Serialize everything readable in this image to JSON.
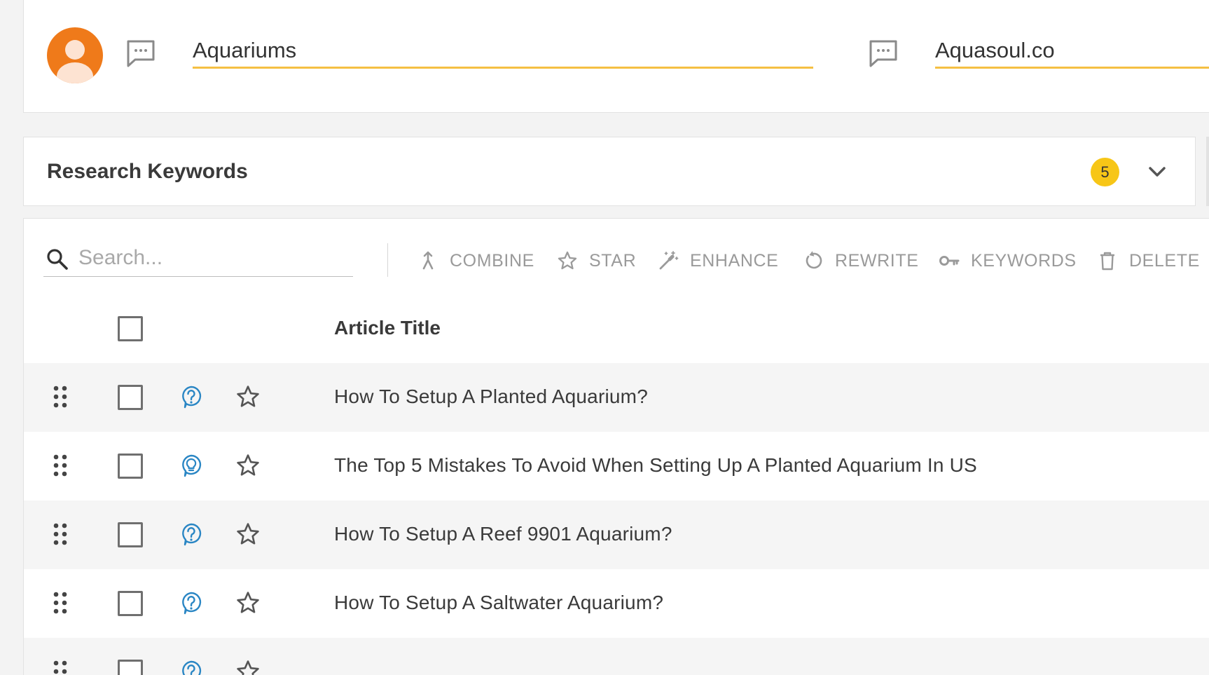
{
  "project": {
    "name": "Aquariums",
    "site": "Aquasoul.co"
  },
  "section": {
    "title": "Research Keywords",
    "badge_count": "5"
  },
  "toolbar": {
    "search_placeholder": "Search...",
    "buttons": [
      {
        "label": "COMBINE",
        "icon": "merge-icon"
      },
      {
        "label": "STAR",
        "icon": "star-outline-icon"
      },
      {
        "label": "ENHANCE",
        "icon": "magic-wand-icon"
      },
      {
        "label": "REWRITE",
        "icon": "refresh-icon"
      },
      {
        "label": "KEYWORDS",
        "icon": "key-icon"
      },
      {
        "label": "DELETE",
        "icon": "trash-icon"
      }
    ]
  },
  "table": {
    "header_title": "Article Title",
    "rows": [
      {
        "title": "How To Setup A Planted Aquarium?",
        "type_icon": "question-bubble-icon"
      },
      {
        "title": "The Top 5 Mistakes To Avoid When Setting Up A Planted Aquarium In US",
        "type_icon": "lightbulb-bubble-icon"
      },
      {
        "title": "How To Setup A Reef 9901 Aquarium?",
        "type_icon": "question-bubble-icon"
      },
      {
        "title": "How To Setup A Saltwater Aquarium?",
        "type_icon": "question-bubble-icon"
      },
      {
        "title": "",
        "type_icon": "question-bubble-icon"
      }
    ]
  },
  "colors": {
    "accent_underline": "#f5c043",
    "badge": "#f7c617",
    "avatar": "#ef7a1a",
    "icon_blue": "#2a86c4"
  }
}
